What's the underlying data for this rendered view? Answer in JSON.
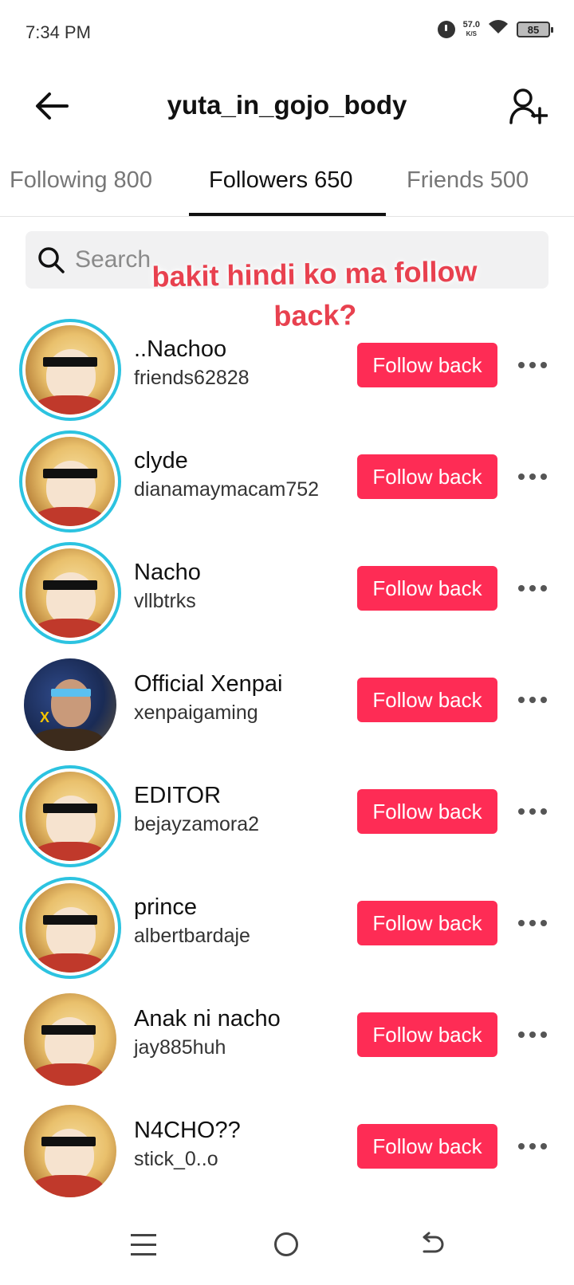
{
  "status": {
    "time": "7:34 PM",
    "net_speed": "57.0",
    "net_unit": "K/S",
    "battery": "85"
  },
  "header": {
    "title": "yuta_in_gojo_body",
    "back_icon": "arrow-left-icon",
    "add_icon": "person-add-icon"
  },
  "tabs": [
    {
      "label": "Following 800",
      "active": false
    },
    {
      "label": "Followers 650",
      "active": true
    },
    {
      "label": "Friends 500",
      "active": false
    }
  ],
  "search": {
    "placeholder": "Search"
  },
  "overlay": {
    "line1": "bakit hindi ko ma follow",
    "line2": "back?"
  },
  "followers": [
    {
      "name": "..Nachoo",
      "handle": "friends62828",
      "button": "Follow back",
      "ring": true,
      "avatar": "shades-girl"
    },
    {
      "name": "clyde",
      "handle": "dianamaymacam752",
      "button": "Follow back",
      "ring": true,
      "avatar": "shades-girl"
    },
    {
      "name": "Nacho",
      "handle": "vllbtrks",
      "button": "Follow back",
      "ring": true,
      "avatar": "shades-girl"
    },
    {
      "name": "Official Xenpai",
      "handle": "xenpaigaming",
      "button": "Follow back",
      "ring": false,
      "avatar": "xenpai"
    },
    {
      "name": "EDITOR",
      "handle": "bejayzamora2",
      "button": "Follow back",
      "ring": true,
      "avatar": "shades-girl"
    },
    {
      "name": "prince",
      "handle": "albertbardaje",
      "button": "Follow back",
      "ring": true,
      "avatar": "shades-girl"
    },
    {
      "name": "Anak ni nacho",
      "handle": "jay885huh",
      "button": "Follow back",
      "ring": false,
      "avatar": "shades-girl"
    },
    {
      "name": "N4CHO??",
      "handle": "stick_0..o",
      "button": "Follow back",
      "ring": false,
      "avatar": "shades-girl"
    }
  ],
  "colors": {
    "accent": "#fe2c55",
    "story_ring": "#2cc3e0",
    "overlay_text": "#e8414f"
  }
}
